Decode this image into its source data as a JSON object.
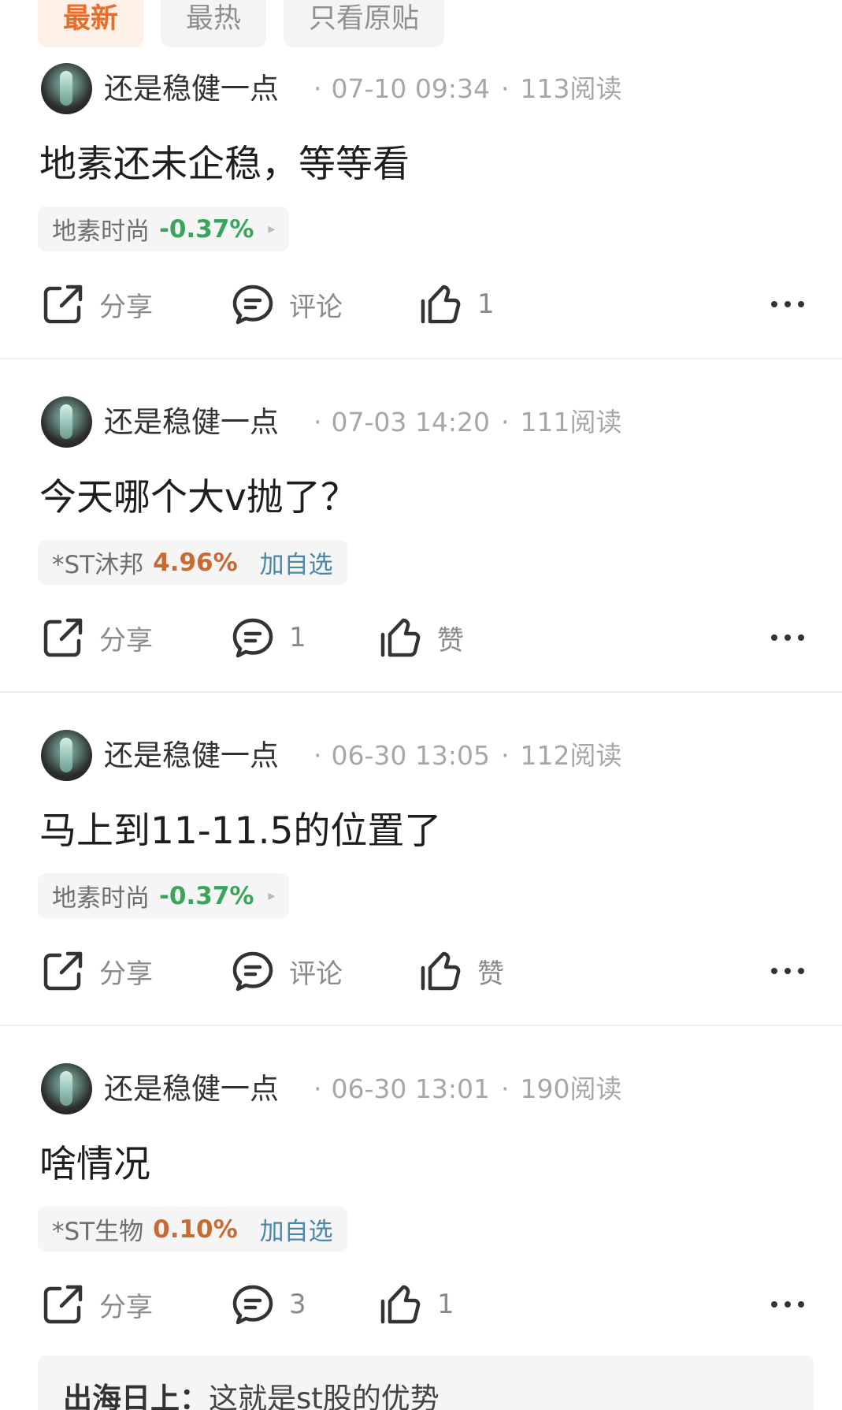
{
  "tabs": [
    {
      "label": "最新",
      "active": true
    },
    {
      "label": "最热",
      "active": false
    },
    {
      "label": "只看原贴",
      "active": false
    }
  ],
  "posts": [
    {
      "author": "还是稳健一点",
      "time": "07-10 09:34",
      "reads": "113阅读",
      "content": "地素还未企稳，等等看",
      "stock": {
        "name": "地素时尚",
        "change": "-0.37%",
        "direction": "down",
        "action": "▸"
      },
      "share_label": "分享",
      "comment_label": "评论",
      "like_label": "1"
    },
    {
      "author": "还是稳健一点",
      "time": "07-03 14:20",
      "reads": "111阅读",
      "content": "今天哪个大v抛了？",
      "stock": {
        "name": "*ST沐邦",
        "change": "4.96%",
        "direction": "up",
        "action": "加自选"
      },
      "share_label": "分享",
      "comment_label": "1",
      "like_label": "赞"
    },
    {
      "author": "还是稳健一点",
      "time": "06-30 13:05",
      "reads": "112阅读",
      "content": "马上到11-11.5的位置了",
      "stock": {
        "name": "地素时尚",
        "change": "-0.37%",
        "direction": "down",
        "action": "▸"
      },
      "share_label": "分享",
      "comment_label": "评论",
      "like_label": "赞"
    },
    {
      "author": "还是稳健一点",
      "time": "06-30 13:01",
      "reads": "190阅读",
      "content": "啥情况",
      "stock": {
        "name": "*ST生物",
        "change": "0.10%",
        "direction": "up",
        "action": "加自选"
      },
      "share_label": "分享",
      "comment_label": "3",
      "like_label": "1"
    }
  ],
  "reply": {
    "name": "出海日上：",
    "text": "这就是st股的优势"
  },
  "colors": {
    "accent": "#e86d2b",
    "down": "#3aa55a",
    "up": "#c86a33",
    "link": "#4c86a8"
  }
}
